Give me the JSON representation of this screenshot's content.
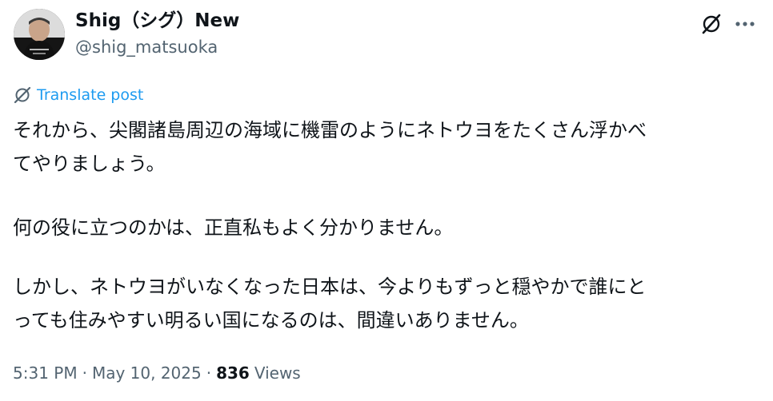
{
  "author": {
    "display_name": "Shig（シグ）New",
    "handle": "@shig_matsuoka",
    "avatar": "profile-photo"
  },
  "header_actions": {
    "grok_icon": "grok-slash-circle-icon",
    "more_icon": "more-dots-icon"
  },
  "translate": {
    "icon": "translate-slash-circle-icon",
    "label": "Translate post"
  },
  "post": {
    "paragraph_1_line_1": "それから、尖閣諸島周辺の海域に機雷のようにネトウヨをたくさん浮かべ",
    "paragraph_1_line_2": "てやりましょう。",
    "paragraph_2": "何の役に立つのかは、正直私もよく分かりません。",
    "paragraph_3_line_1": "しかし、ネトウヨがいなくなった日本は、今よりもずっと穏やかで誰にと",
    "paragraph_3_line_2": "っても住みやすい明るい国になるのは、間違いありません。"
  },
  "meta": {
    "time": "5:31 PM",
    "separator": "·",
    "date": "May 10, 2025",
    "views_count": "836",
    "views_label": "Views"
  },
  "colors": {
    "text_primary": "#0f1419",
    "text_secondary": "#536471",
    "link_blue": "#1d9bf0"
  }
}
